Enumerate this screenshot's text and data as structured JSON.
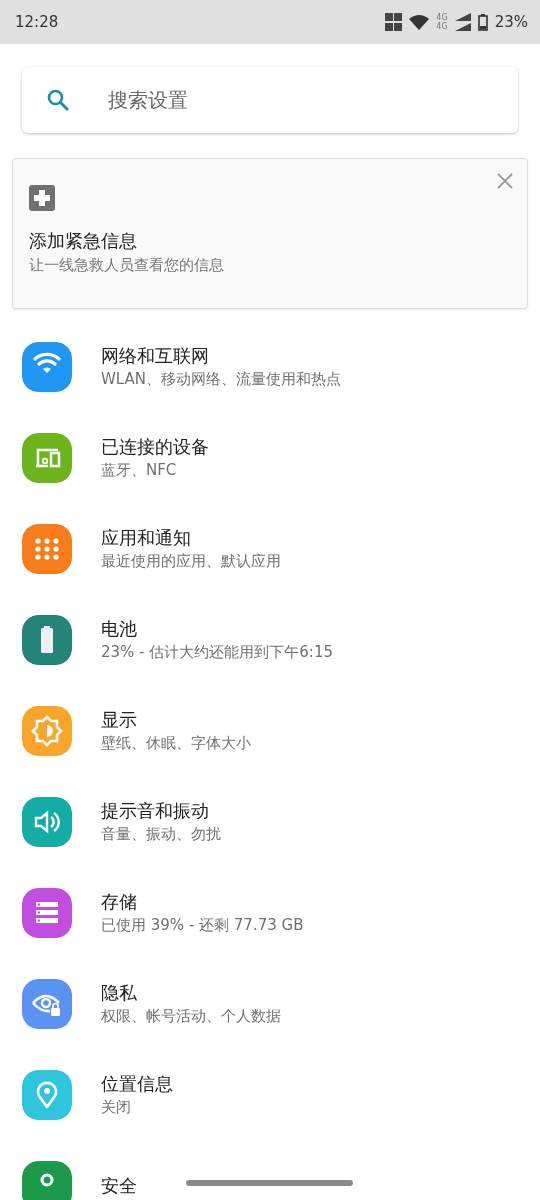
{
  "status_bar": {
    "time": "12:28",
    "network": "4G",
    "network_2": "4G",
    "battery": "23%"
  },
  "search": {
    "placeholder": "搜索设置"
  },
  "suggestion_card": {
    "title": "添加紧急信息",
    "subtitle": "让一线急救人员查看您的信息"
  },
  "settings": [
    {
      "kind": "wifi",
      "color": "#2196f3",
      "title": "网络和互联网",
      "subtitle": "WLAN、移动网络、流量使用和热点"
    },
    {
      "kind": "devices",
      "color": "#6cb51f",
      "title": "已连接的设备",
      "subtitle": "蓝牙、NFC"
    },
    {
      "kind": "apps",
      "color": "#f97c1c",
      "title": "应用和通知",
      "subtitle": "最近使用的应用、默认应用"
    },
    {
      "kind": "battery",
      "color": "#258478",
      "title": "电池",
      "subtitle": "23% - 估计大约还能用到下午6:15"
    },
    {
      "kind": "display",
      "color": "#f9a52c",
      "title": "显示",
      "subtitle": "壁纸、休眠、字体大小"
    },
    {
      "kind": "sound",
      "color": "#14aca4",
      "title": "提示音和振动",
      "subtitle": "音量、振动、勿扰"
    },
    {
      "kind": "storage",
      "color": "#c24ee0",
      "title": "存储",
      "subtitle": "已使用 39% - 还剩 77.73 GB"
    },
    {
      "kind": "privacy",
      "color": "#5b93f4",
      "title": "隐私",
      "subtitle": "权限、帐号活动、个人数据"
    },
    {
      "kind": "location",
      "color": "#2fc5dc",
      "title": "位置信息",
      "subtitle": "关闭"
    },
    {
      "kind": "security",
      "color": "#1b9a4c",
      "title": "安全"
    }
  ]
}
